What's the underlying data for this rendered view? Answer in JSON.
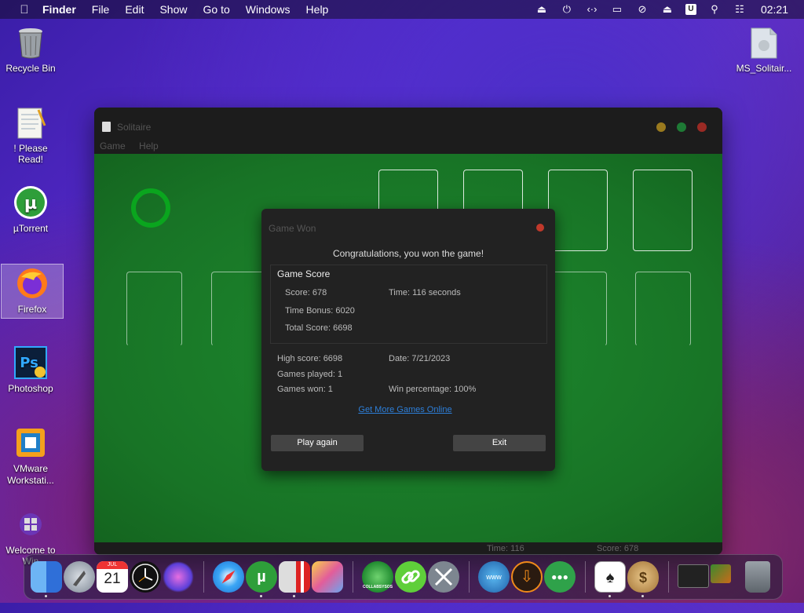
{
  "menubar": {
    "app": "Finder",
    "items": [
      "File",
      "Edit",
      "Show",
      "Go to",
      "Windows",
      "Help"
    ],
    "clock": "02:21",
    "status_icons": [
      "eject-icon",
      "power-icon",
      "code-icon",
      "display-icon",
      "mute-icon",
      "eject-icon",
      "user-icon",
      "search-icon",
      "control-center-icon"
    ],
    "user_badge": "U"
  },
  "desktop_icons": [
    {
      "label": "Recycle Bin",
      "icon": "recycle-bin-icon"
    },
    {
      "label": "! Please Read!",
      "icon": "notepad-icon"
    },
    {
      "label": "µTorrent",
      "icon": "utorrent-icon"
    },
    {
      "label": "Firefox",
      "icon": "firefox-icon"
    },
    {
      "label": "Photoshop",
      "icon": "photoshop-icon"
    },
    {
      "label": "VMware Workstati...",
      "icon": "vmware-icon"
    },
    {
      "label": "Welcome to Win",
      "icon": "windows-icon"
    },
    {
      "label": "MS_Solitair...",
      "icon": "folder-icon"
    }
  ],
  "solitaire": {
    "title": "Solitaire",
    "menu": [
      "Game",
      "Help"
    ],
    "status_time": "Time: 116",
    "status_score": "Score: 678"
  },
  "dialog": {
    "title": "Game Won",
    "message": "Congratulations, you won the game!",
    "group_title": "Game Score",
    "score": "Score: 678",
    "time": "Time:  116 seconds",
    "time_bonus": "Time Bonus: 6020",
    "total_score": "Total Score: 6698",
    "high_score": "High score: 6698",
    "date": "Date: 7/21/2023",
    "games_played": "Games played: 1",
    "games_won": "Games won: 1",
    "win_percentage": "Win percentage: 100%",
    "link": "Get More Games Online",
    "play_again": "Play again",
    "exit": "Exit"
  },
  "dock": {
    "calendar_month": "JUL",
    "calendar_day": "21",
    "items": [
      "finder-icon",
      "launchpad-icon",
      "calendar-icon",
      "clock-icon",
      "siri-icon",
      "safari-icon",
      "utorrent-icon",
      "parallels-icon",
      "preview-icon",
      "collabsysos-icon",
      "link-icon",
      "tools-icon",
      "network-icon",
      "download-icon",
      "drops-icon",
      "solitaire-icon",
      "money-bag-icon",
      "terminal-icon",
      "thumbnail-icon",
      "trash-icon"
    ],
    "collab_label": "COLLABSYSOS"
  },
  "colors": {
    "felt": "#187426",
    "link": "#2d7fd9",
    "close": "#c0392b",
    "minimize": "#c9a227",
    "maximize": "#2ea043"
  }
}
